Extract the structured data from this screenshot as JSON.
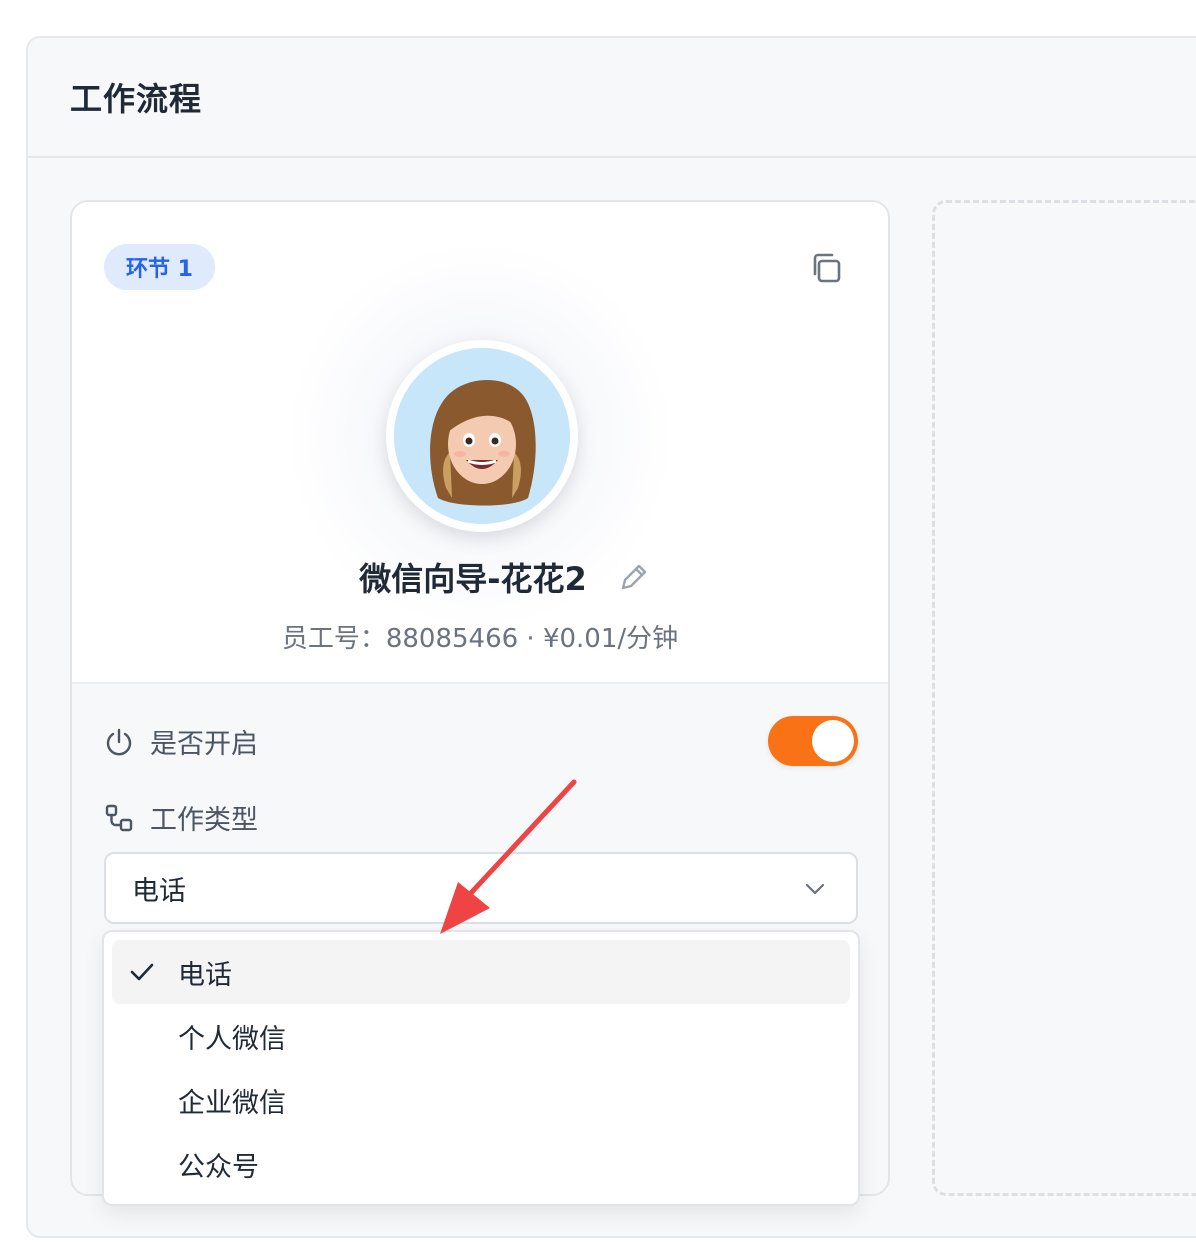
{
  "panel": {
    "title": "工作流程"
  },
  "card": {
    "badge": "环节 1",
    "agent_name": "微信向导-花花2",
    "employee_info": "员工号：88085466 · ¥0.01/分钟",
    "enable_label": "是否开启",
    "enabled": true,
    "work_type_label": "工作类型",
    "work_type_value": "电话",
    "icons": {
      "copy": "copy-icon",
      "edit": "pencil-icon",
      "power": "power-icon",
      "flow": "workflow-icon",
      "chevron": "chevron-down-icon"
    }
  },
  "dropdown": {
    "options": [
      {
        "label": "电话",
        "selected": true
      },
      {
        "label": "个人微信",
        "selected": false
      },
      {
        "label": "企业微信",
        "selected": false
      },
      {
        "label": "公众号",
        "selected": false
      }
    ]
  },
  "colors": {
    "accent_orange": "#f97316",
    "badge_blue": "#2563eb",
    "badge_bg": "#dfeafc",
    "annotation_red": "#ef4444"
  }
}
